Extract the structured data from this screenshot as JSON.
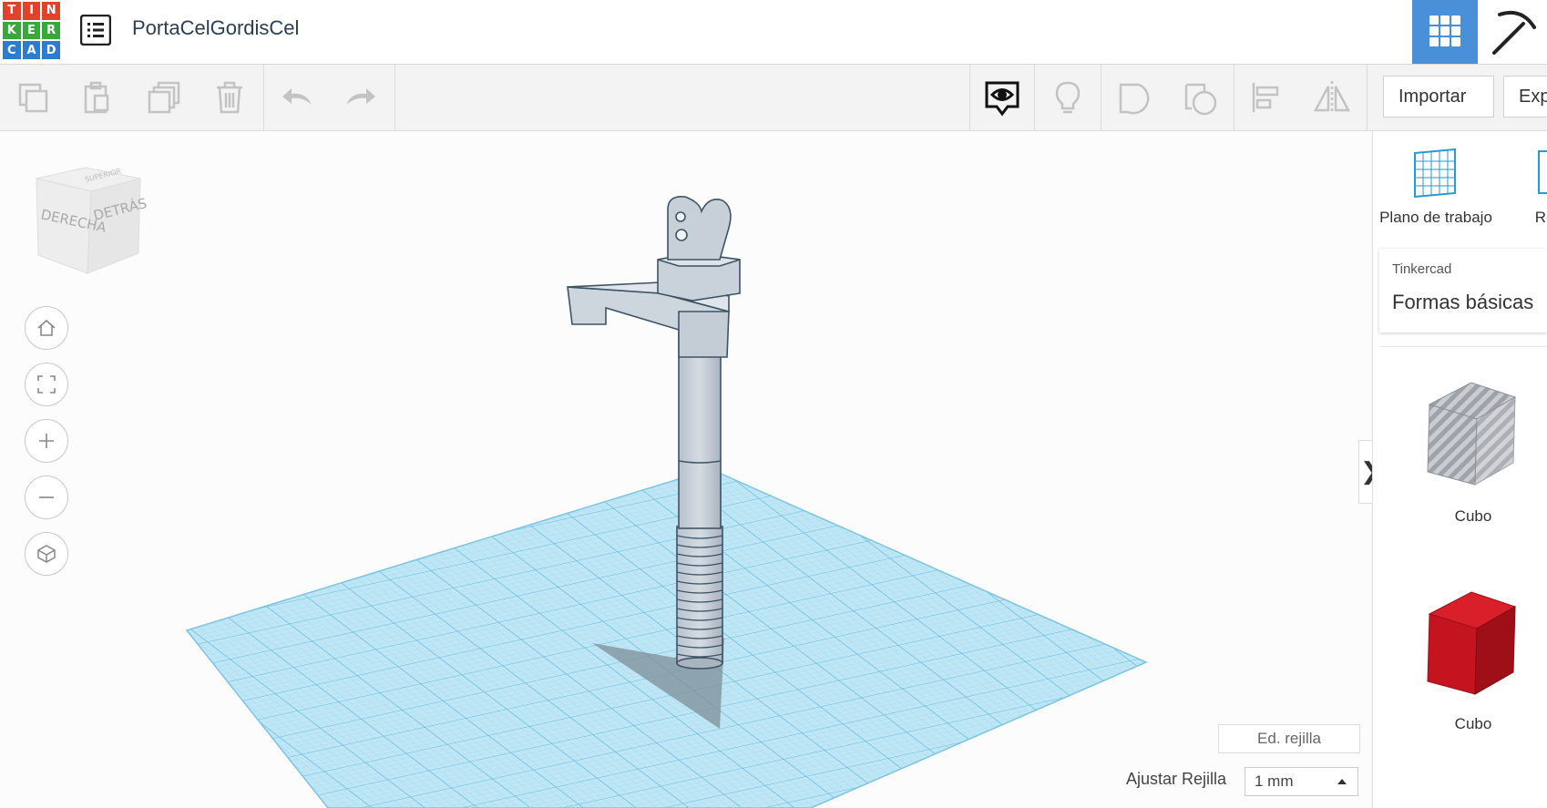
{
  "logo": {
    "letters": [
      "T",
      "I",
      "N",
      "K",
      "E",
      "R",
      "C",
      "A",
      "D"
    ],
    "colors": [
      "#e2412c",
      "#e2412c",
      "#e2412c",
      "#37a93c",
      "#37a93c",
      "#37a93c",
      "#2a7dd1",
      "#2a7dd1",
      "#2a7dd1"
    ]
  },
  "header": {
    "title": "PortaCelGordisCel",
    "accent": "#4a90d9"
  },
  "toolbar": {
    "import_label": "Importar",
    "export_label": "Exportar"
  },
  "viewcube": {
    "face_right": "DERECHA",
    "face_back": "DETRÁS",
    "face_top": "SUPERIOR"
  },
  "grid": {
    "edit_label": "Ed. rejilla",
    "snap_label": "Ajustar Rejilla",
    "snap_value": "1 mm"
  },
  "panel": {
    "workplane_label": "Plano de trabajo",
    "ruler_label": "Regla",
    "category_small": "Tinkercad",
    "category_big": "Formas básicas",
    "shapes": [
      {
        "label": "Cubo"
      },
      {
        "label": "Cubo"
      }
    ]
  }
}
